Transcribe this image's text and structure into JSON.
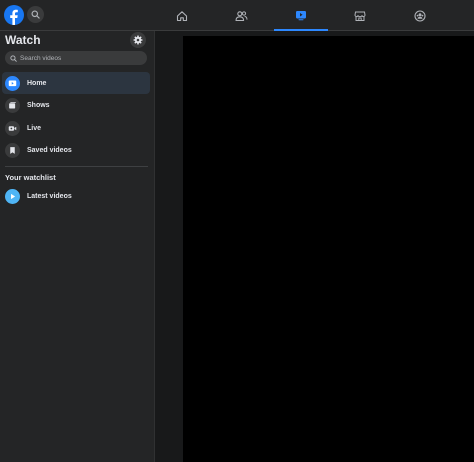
{
  "topbar": {
    "logo_icon": "facebook-logo-icon",
    "search_icon": "search-icon",
    "tabs": [
      {
        "name": "home",
        "icon": "home-icon",
        "active": false
      },
      {
        "name": "friends",
        "icon": "friends-icon",
        "active": false
      },
      {
        "name": "watch",
        "icon": "watch-icon",
        "active": true
      },
      {
        "name": "marketplace",
        "icon": "marketplace-icon",
        "active": false
      },
      {
        "name": "groups",
        "icon": "groups-icon",
        "active": false
      }
    ]
  },
  "sidebar": {
    "title": "Watch",
    "settings_icon": "gear-icon",
    "search": {
      "placeholder": "Search videos"
    },
    "items": [
      {
        "label": "Home",
        "icon": "watch-home-icon",
        "active": true
      },
      {
        "label": "Shows",
        "icon": "shows-icon",
        "active": false
      },
      {
        "label": "Live",
        "icon": "live-icon",
        "active": false
      },
      {
        "label": "Saved videos",
        "icon": "bookmark-icon",
        "active": false
      }
    ],
    "watchlist_heading": "Your watchlist",
    "watchlist": [
      {
        "label": "Latest videos",
        "icon": "play-icon"
      }
    ]
  },
  "colors": {
    "accent": "#2d88ff",
    "brand": "#1877f2",
    "surface": "#242526",
    "background": "#18191a",
    "video": "#000000"
  }
}
